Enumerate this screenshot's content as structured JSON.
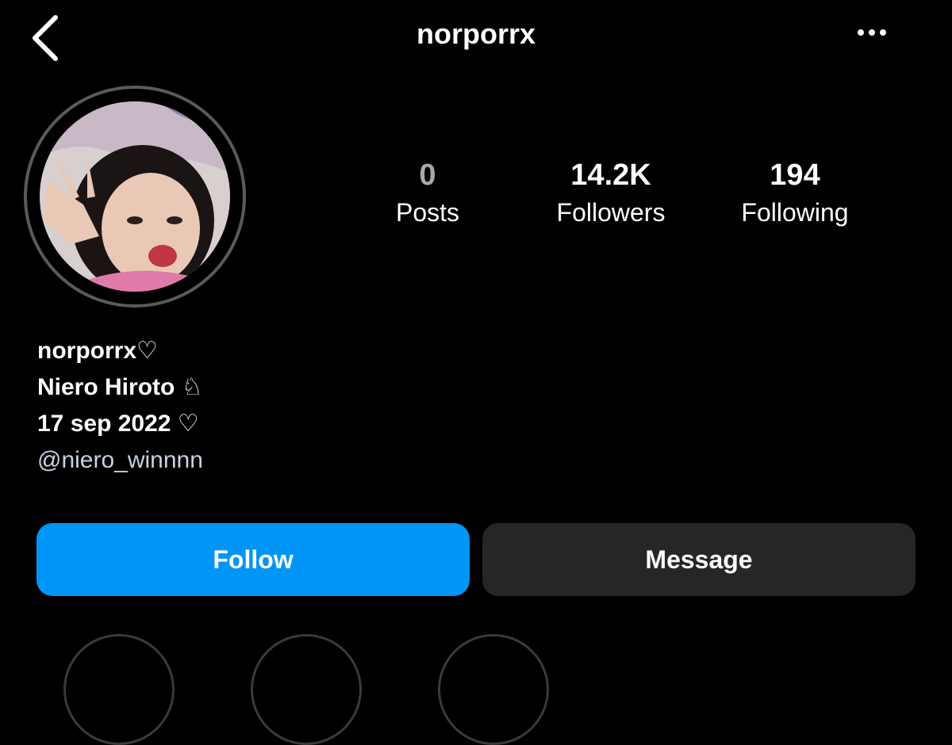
{
  "header": {
    "username": "norporrx"
  },
  "profile": {
    "stats": [
      {
        "value": "0",
        "label": "Posts"
      },
      {
        "value": "14.2K",
        "label": "Followers"
      },
      {
        "value": "194",
        "label": "Following"
      }
    ],
    "bio": {
      "name": "norporrx♡",
      "line1": "Niero Hiroto ♘",
      "line2": "17 sep 2022 ♡",
      "link": "@niero_winnnn"
    }
  },
  "actions": {
    "follow": "Follow",
    "message": "Message"
  },
  "colors": {
    "follow_bg": "#0195f7",
    "message_bg": "#262626",
    "background": "#000000"
  }
}
